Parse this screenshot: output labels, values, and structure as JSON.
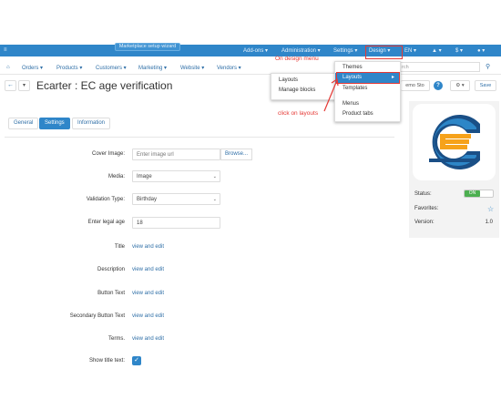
{
  "topbar": {
    "wizard": "Marketplace setup wizard",
    "addons": "Add-ons ▾",
    "administration": "Administration ▾",
    "settings": "Settings ▾",
    "design": "Design ▾",
    "lang": "EN ▾",
    "bell": "▾",
    "currency": "$ ▾",
    "user": "▾"
  },
  "nav": {
    "home_icon": "home-icon",
    "items": [
      "Orders ▾",
      "Products ▾",
      "Customers ▾",
      "Marketing ▾",
      "Website ▾",
      "Vendors ▾"
    ],
    "search_placeholder": "rch"
  },
  "title_row": {
    "back": "←",
    "dropdown": "▾",
    "title": "Ecarter : EC age verification",
    "demo_store": "emo Sto",
    "help": "?",
    "gear": "⚙ ▾",
    "save": "Save"
  },
  "tabs": [
    "General",
    "Settings",
    "Information"
  ],
  "active_tab": "Settings",
  "form": {
    "cover_image_label": "Cover Image:",
    "cover_image_placeholder": "Enter image url",
    "browse": "Browse...",
    "media_label": "Media:",
    "media_value": "Image",
    "validation_label": "Validation Type:",
    "validation_value": "Birthday",
    "legal_age_label": "Enter legal age",
    "legal_age_value": "18",
    "title_label": "Title",
    "description_label": "Description",
    "button_text_label": "Button Text",
    "secondary_button_label": "Secondary Button Text",
    "terms_label": "Terms.",
    "show_title_label": "Show title text:",
    "view_and_edit": "view and edit"
  },
  "sidebar": {
    "status_label": "Status:",
    "status_value": "ON",
    "favorites_label": "Favorites:",
    "version_label": "Version:",
    "version_value": "1.0"
  },
  "settings_menu": [
    "Layouts",
    "Manage blocks"
  ],
  "design_menu": [
    "Themes",
    "Layouts",
    "Templates",
    "Menus",
    "Product tabs"
  ],
  "design_menu_highlight": "Layouts",
  "annotations": {
    "design_note": "On design menu",
    "layouts_note": "click on layouts"
  },
  "colors": {
    "brand": "#2f86c9",
    "annotation": "#e53935",
    "status_on": "#4caf50"
  }
}
